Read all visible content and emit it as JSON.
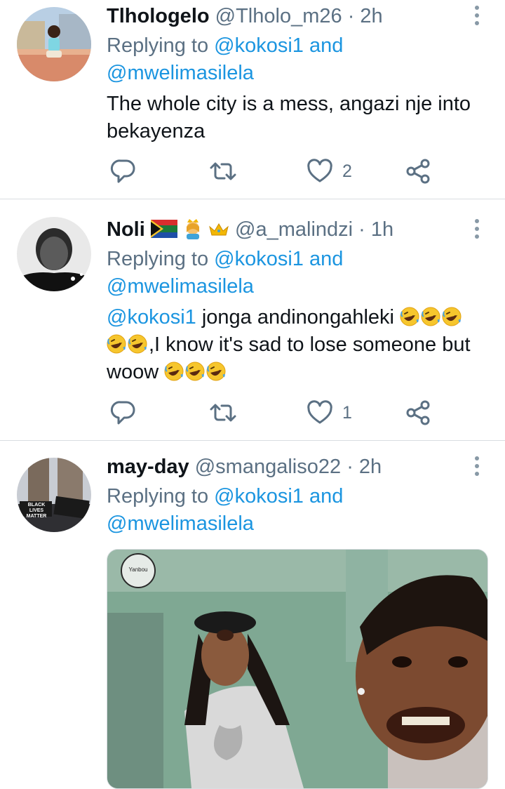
{
  "tweets": [
    {
      "name": "Tlhologelo",
      "handle": "@Tlholo_m26",
      "sep": "·",
      "time": "2h",
      "replying_prefix": "Replying to ",
      "mention1": "@kokosi1",
      "and": " and",
      "mention2": "@mwelimasilela",
      "text_line1": "The whole city is a mess, angazi nje into",
      "text_line2": "bekayenza",
      "like_count": "2"
    },
    {
      "name": "Noli",
      "handle": "@a_malindzi",
      "sep": "·",
      "time": "1h",
      "replying_prefix": "Replying to ",
      "mention1": "@kokosi1",
      "and": " and",
      "mention2": "@mwelimasilela",
      "text_mention": "@kokosi1",
      "text_part1": " jonga andinongahleki ",
      "text_part2": ",I know it's sad to lose someone but",
      "text_part3": "woow ",
      "like_count": "1"
    },
    {
      "name": "may-day",
      "handle": "@smangaliso22",
      "sep": "·",
      "time": "2h",
      "replying_prefix": "Replying to ",
      "mention1": "@kokosi1",
      "and": " and",
      "mention2": "@mwelimasilela"
    }
  ],
  "avatar3_sign": "BLACK LIVES MATTER",
  "media_logo": "Yanbou",
  "colors": {
    "link": "#1b95e0",
    "secondary": "#5b7083",
    "divider": "#d9dde1",
    "text": "#0f1419"
  },
  "icons": [
    "reply-icon",
    "retweet-icon",
    "like-icon",
    "share-icon",
    "more-icon"
  ]
}
